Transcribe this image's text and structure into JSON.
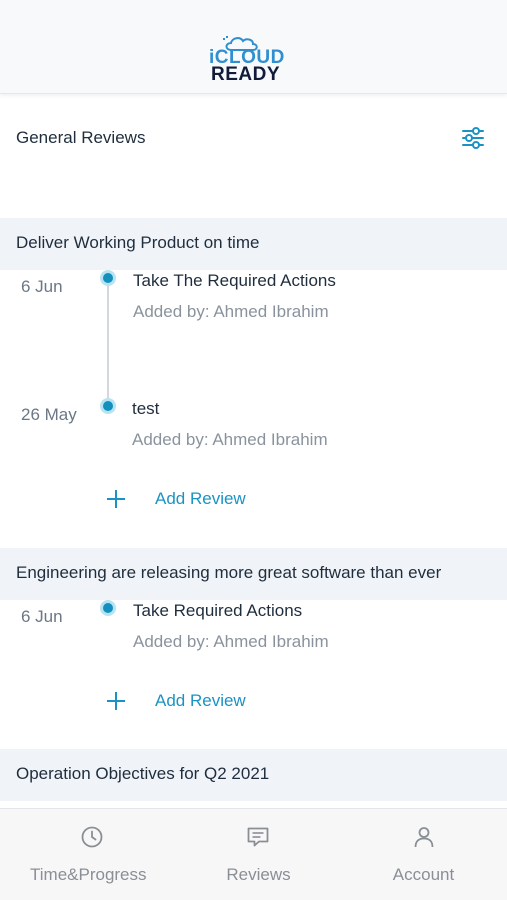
{
  "header": {
    "logo_line1": "iCLOUD",
    "logo_line2": "READY"
  },
  "reviews": {
    "title": "General Reviews"
  },
  "groups": [
    {
      "title": "Deliver Working Product on time",
      "entries": [
        {
          "date": "6 Jun",
          "title": "Take The Required Actions",
          "added_by": "Added by: Ahmed Ibrahim"
        },
        {
          "date": "26 May",
          "title": "test",
          "added_by": "Added by: Ahmed Ibrahim"
        }
      ],
      "add_label": "Add Review"
    },
    {
      "title": "Engineering are releasing more great software than ever",
      "entries": [
        {
          "date": "6 Jun",
          "title": "Take Required Actions",
          "added_by": "Added by: Ahmed Ibrahim"
        }
      ],
      "add_label": "Add Review"
    },
    {
      "title": "Operation Objectives for Q2 2021"
    }
  ],
  "tabs": [
    {
      "label": "Time&Progress",
      "icon": "clock-icon"
    },
    {
      "label": "Reviews",
      "icon": "chat-icon"
    },
    {
      "label": "Account",
      "icon": "person-icon"
    }
  ],
  "colors": {
    "accent": "#1a93c4",
    "dot": "#1390bf",
    "group_bg": "#f0f4f8",
    "logo_blue": "#2f8fd1",
    "logo_dark": "#0f1d3a"
  }
}
